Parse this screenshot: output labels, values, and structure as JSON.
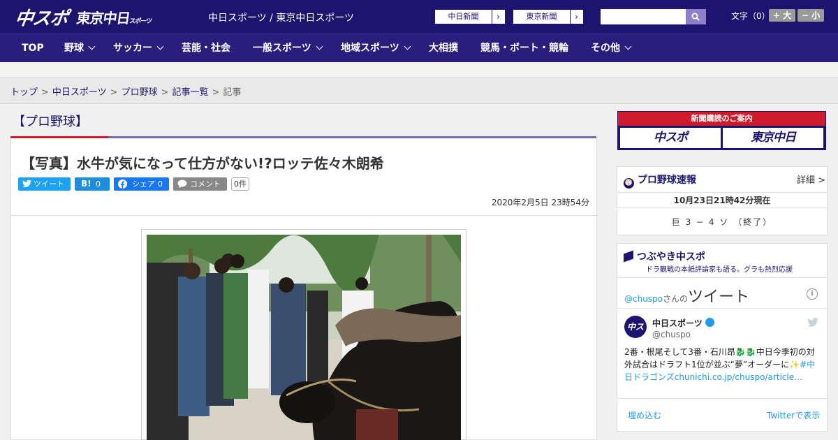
{
  "header": {
    "logo_main": "中スポ",
    "logo_tokyo": "東京中日",
    "logo_tokyo_suffix": "スポーツ",
    "site_title": "中日スポーツ / 東京中日スポーツ",
    "paper_buttons": [
      {
        "label": "中日新聞",
        "arrow": "›"
      },
      {
        "label": "東京新聞",
        "arrow": "›"
      }
    ],
    "search_placeholder": "",
    "font_size_label": "文字（0）",
    "font_bigger": "+ 大",
    "font_smaller": "− 小",
    "colors": {
      "header_bg": "#1d1470",
      "nav_bg": "#2b1d7c",
      "accent_red": "#cf1b2e"
    }
  },
  "nav": {
    "items": [
      {
        "label": "TOP",
        "has_menu": false
      },
      {
        "label": "野球",
        "has_menu": true
      },
      {
        "label": "サッカー",
        "has_menu": true
      },
      {
        "label": "芸能・社会",
        "has_menu": false
      },
      {
        "label": "一般スポーツ",
        "has_menu": true
      },
      {
        "label": "地域スポーツ",
        "has_menu": true
      },
      {
        "label": "大相撲",
        "has_menu": false
      },
      {
        "label": "競馬・ボート・競輪",
        "has_menu": false
      },
      {
        "label": "その他",
        "has_menu": true
      }
    ]
  },
  "breadcrumb": {
    "items": [
      "トップ",
      "中日スポーツ",
      "プロ野球",
      "記事一覧"
    ],
    "current": "記事",
    "separator": ">"
  },
  "article": {
    "section": "【プロ野球】",
    "title": "【写真】水牛が気になって仕方がない!?ロッテ佐々木朗希",
    "share": {
      "tweet": "ツイート",
      "hatena_label": "B!",
      "hatena_count": "0",
      "facebook": "シェア",
      "facebook_count": "0",
      "comment": "コメント",
      "comment_count": "0件"
    },
    "date": "2020年2月5日 23時54分"
  },
  "sidebar": {
    "subscribe": {
      "heading": "新聞購読のご案内",
      "logo_left": "中スポ",
      "logo_right": "東京中日"
    },
    "scores": {
      "title": "プロ野球速報",
      "detail_label": "詳細 >",
      "timestamp": "10月23日21時42分現在",
      "game": "巨 3 − 4 ソ （終了）"
    },
    "twitter": {
      "title": "つぶやき中スポ",
      "subtitle": "ドラ観戦の本紙評論家も語る。グラも熱烈応援",
      "handle_at": "@chuspo",
      "handle_suffix": "さんの",
      "tweets_label": "ツイート",
      "info": "i",
      "user_name": "中日スポーツ",
      "user_handle": "@chuspo",
      "avatar_text": "中ス",
      "tweet_text": "2番・根尾そして3番・石川昂🐉🐉中日今季初の対外試合はドラフト1位が並ぶ“夢”オーダーに✨",
      "tweet_link": "#中日ドラゴンズchunichi.co.jp/chuspo/article…",
      "embed_label": "埋め込む",
      "view_label": "Twitterで表示"
    }
  }
}
